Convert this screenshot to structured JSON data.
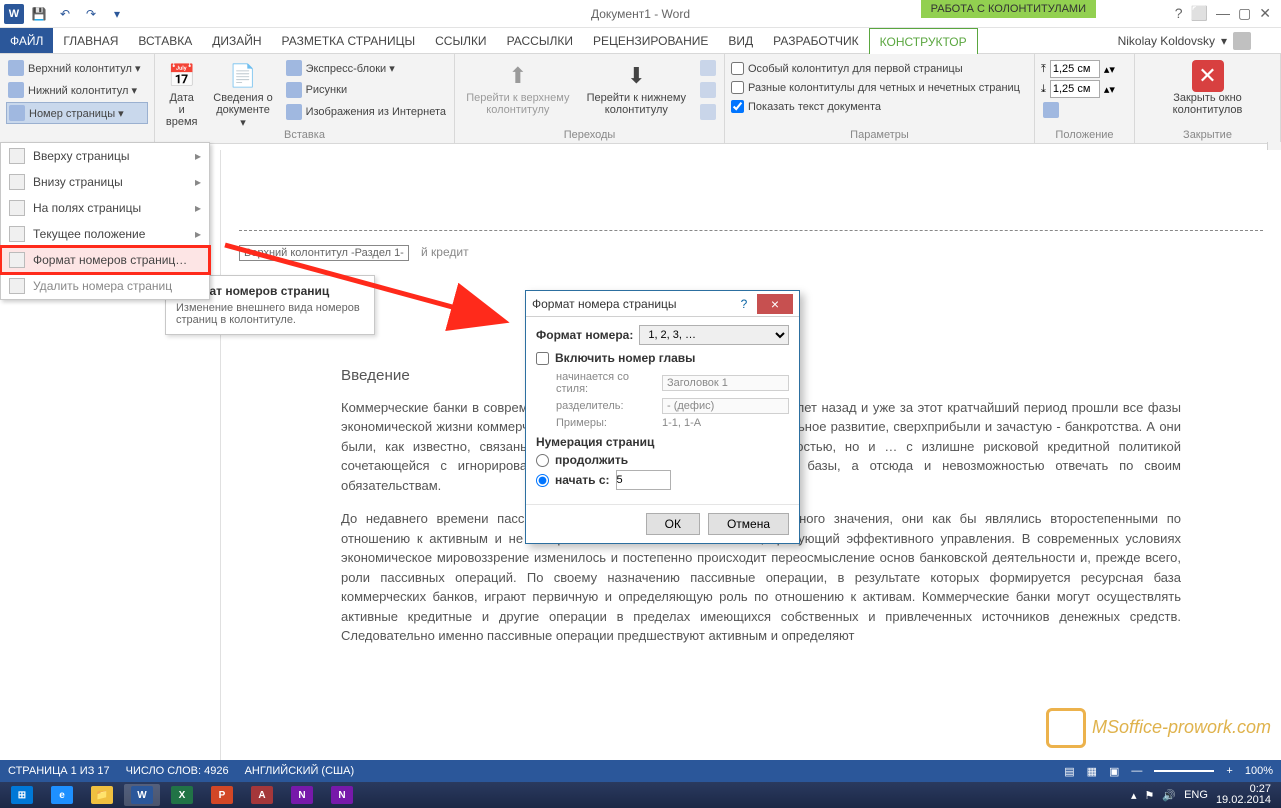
{
  "title": "Документ1 - Word",
  "context_tab_group": "РАБОТА С КОЛОНТИТУЛАМИ",
  "user": "Nikolay Koldovsky",
  "tabs": {
    "file": "ФАЙЛ",
    "home": "ГЛАВНАЯ",
    "insert": "ВСТАВКА",
    "design": "ДИЗАЙН",
    "layout": "РАЗМЕТКА СТРАНИЦЫ",
    "references": "ССЫЛКИ",
    "mailings": "РАССЫЛКИ",
    "review": "РЕЦЕНЗИРОВАНИЕ",
    "view": "ВИД",
    "developer": "РАЗРАБОТЧИК",
    "constructor": "КОНСТРУКТОР"
  },
  "ribbon": {
    "header_footer": {
      "top": "Верхний колонтитул ▾",
      "bottom": "Нижний колонтитул ▾",
      "page_number": "Номер страницы ▾"
    },
    "insert_group": {
      "date_time": "Дата и время",
      "doc_info": "Сведения о документе ▾",
      "quick_parts": "Экспресс-блоки ▾",
      "pictures": "Рисунки",
      "online_pictures": "Изображения из Интернета",
      "group_label": "Вставка"
    },
    "nav_group": {
      "goto_header": "Перейти к верхнему колонтитулу",
      "goto_footer": "Перейти к нижнему колонтитулу",
      "group_label": "Переходы"
    },
    "options_group": {
      "first_page": "Особый колонтитул для первой страницы",
      "odd_even": "Разные колонтитулы для четных и нечетных страниц",
      "show_text": "Показать текст документа",
      "group_label": "Параметры"
    },
    "position_group": {
      "top_val": "1,25 см",
      "bottom_val": "1,25 см",
      "group_label": "Положение"
    },
    "close_group": {
      "close": "Закрыть окно колонтитулов",
      "group_label": "Закрытие"
    }
  },
  "menu": {
    "items": [
      "Вверху страницы",
      "Внизу страницы",
      "На полях страницы",
      "Текущее положение",
      "Формат номеров страниц…",
      "Удалить номера страниц"
    ]
  },
  "tooltip": {
    "title": "Формат номеров страниц",
    "body": "Изменение внешнего вида номеров страниц в колонтитуле."
  },
  "dialog": {
    "title": "Формат номера страницы",
    "format_label": "Формат номера:",
    "format_value": "1, 2, 3, …",
    "include_chapter": "Включить номер главы",
    "starts_with_style": "начинается со стиля:",
    "style_value": "Заголовок 1",
    "separator": "разделитель:",
    "separator_value": "- (дефис)",
    "examples": "Примеры:",
    "examples_value": "1-1, 1-A",
    "numbering_title": "Нумерация страниц",
    "continue": "продолжить",
    "start_at": "начать с:",
    "start_value": "5",
    "ok": "ОК",
    "cancel": "Отмена"
  },
  "document": {
    "header_tag": "Верхний колонтитул -Раздел 1-",
    "header_text_right": "й кредит",
    "intro": "Введение",
    "p1": "Коммерческие банки в современной России начали возникать всего 6 - 7 лет назад и уже за этот кратчайший период прошли все фазы экономической жизни коммерческих организаций: становление, стремительное развитие, сверхприбыли и зачастую - банкротства. А они были, как известно, связаны не только с экономической нестабильностью, но и … с излишне рисковой кредитной политикой сочетающейся с игнорированием проблем формирования ресурсной базы, а отсюда и невозможностью отвечать по своим обязательствам.",
    "p2": "До недавнего времени пассивным операциям не придавалось серьезного значения, они как бы являлись второстепенными по отношению к активным и не воспринимались банками как объект, требующий эффективного управления. В современных условиях экономическое мировоззрение изменилось и постепенно происходит переосмысление основ банковской деятельности и, прежде всего, роли пассивных операций. По своему назначению пассивные операции, в результате которых формируется ресурсная база коммерческих банков, играют первичную и определяющую роль по отношению к активам. Коммерческие банки могут осуществлять активные кредитные и другие операции в пределах имеющихся собственных и привлеченных источников денежных средств. Следовательно именно пассивные операции предшествуют активным и определяют"
  },
  "statusbar": {
    "page": "СТРАНИЦА 1 ИЗ 17",
    "words": "ЧИСЛО СЛОВ: 4926",
    "lang": "АНГЛИЙСКИЙ (США)",
    "zoom": "100%"
  },
  "taskbar": {
    "lang": "ENG",
    "time": "0:27",
    "date": "19.02.2014"
  },
  "watermark": "MSoffice-prowork.com"
}
